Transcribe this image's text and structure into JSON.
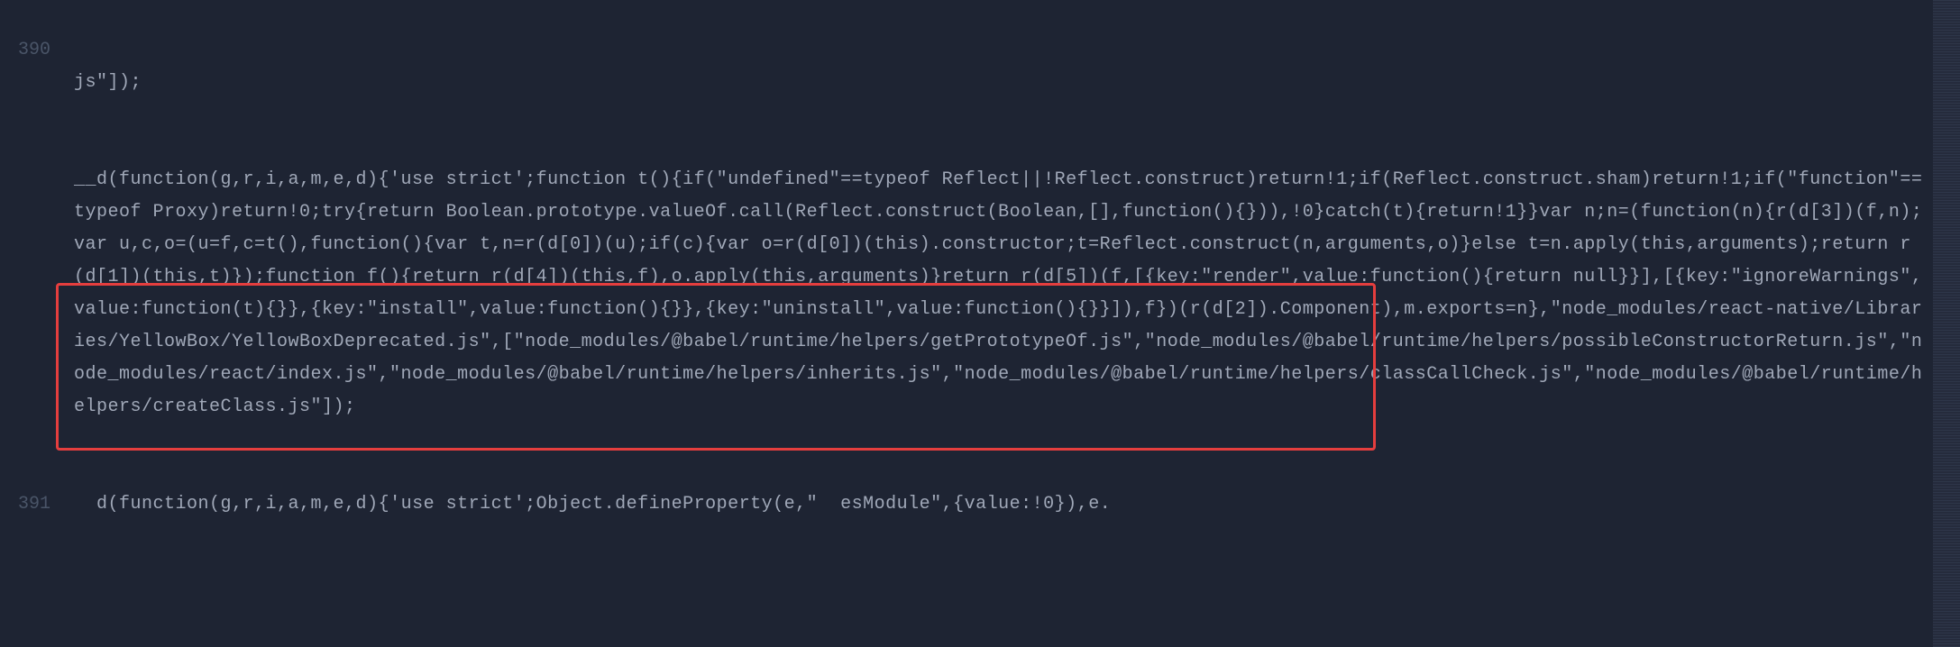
{
  "lineNumbers": {
    "partial_top": "",
    "first": "390",
    "second": "391"
  },
  "code": {
    "line_partial_top": "js\"]);",
    "line_390": "__d(function(g,r,i,a,m,e,d){'use strict';function t(){if(\"undefined\"==typeof Reflect||!Reflect.construct)return!1;if(Reflect.construct.sham)return!1;if(\"function\"==typeof Proxy)return!0;try{return Boolean.prototype.valueOf.call(Reflect.construct(Boolean,[],function(){})),!0}catch(t){return!1}}var n;n=(function(n){r(d[3])(f,n);var u,c,o=(u=f,c=t(),function(){var t,n=r(d[0])(u);if(c){var o=r(d[0])(this).constructor;t=Reflect.construct(n,arguments,o)}else t=n.apply(this,arguments);return r(d[1])(this,t)});function f(){return r(d[4])(this,f),o.apply(this,arguments)}return r(d[5])(f,[{key:\"render\",value:function(){return null}}],[{key:\"ignoreWarnings\",value:function(t){}},{key:\"install\",value:function(){}},{key:\"uninstall\",value:function(){}}]),f})(r(d[2]).Component),m.exports=n},\"node_modules/react-native/Libraries/YellowBox/YellowBoxDeprecated.js\",[\"node_modules/@babel/runtime/helpers/getPrototypeOf.js\",\"node_modules/@babel/runtime/helpers/possibleConstructorReturn.js\",\"node_modules/react/index.js\",\"node_modules/@babel/runtime/helpers/inherits.js\",\"node_modules/@babel/runtime/helpers/classCallCheck.js\",\"node_modules/@babel/runtime/helpers/createClass.js\"]);",
    "line_391": "  d(function(g,r,i,a,m,e,d){'use strict';Object.defineProperty(e,\"  esModule\",{value:!0}),e."
  }
}
